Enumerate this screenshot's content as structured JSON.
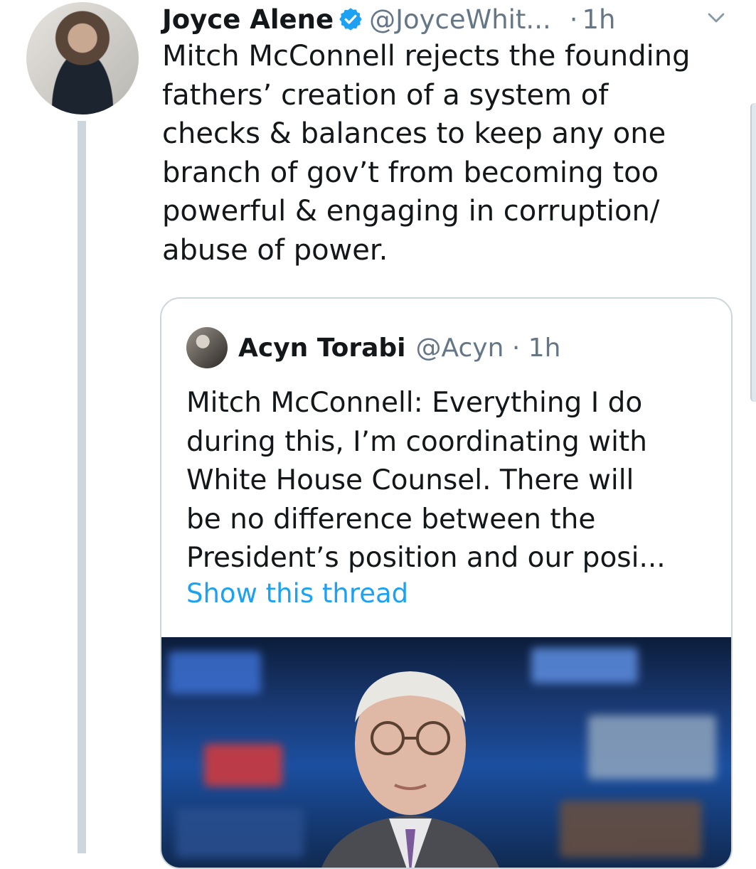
{
  "tweet": {
    "author_name": "Joyce Alene",
    "handle": "@JoyceWhit...",
    "separator": "·",
    "time": "1h",
    "text": "Mitch McConnell rejects the founding\nfathers’ creation of a system of\nchecks & balances to keep any one\nbranch of gov’t from becoming too\npowerful & engaging in corruption/\nabuse of power.",
    "verified_icon": "verified-badge-icon",
    "menu_icon": "chevron-down-icon"
  },
  "quote": {
    "author_name": "Acyn Torabi",
    "handle_time": "@Acyn · 1h",
    "text": "Mitch McConnell: Everything I do\nduring this, I’m coordinating with\nWhite House Counsel. There will\nbe no difference between the\nPresident’s position and our posi...",
    "show_thread": "Show this thread"
  },
  "colors": {
    "text": "#14171a",
    "secondary": "#657786",
    "link": "#1da1f2",
    "verified": "#1da1f2",
    "border": "#ccd6dd"
  }
}
